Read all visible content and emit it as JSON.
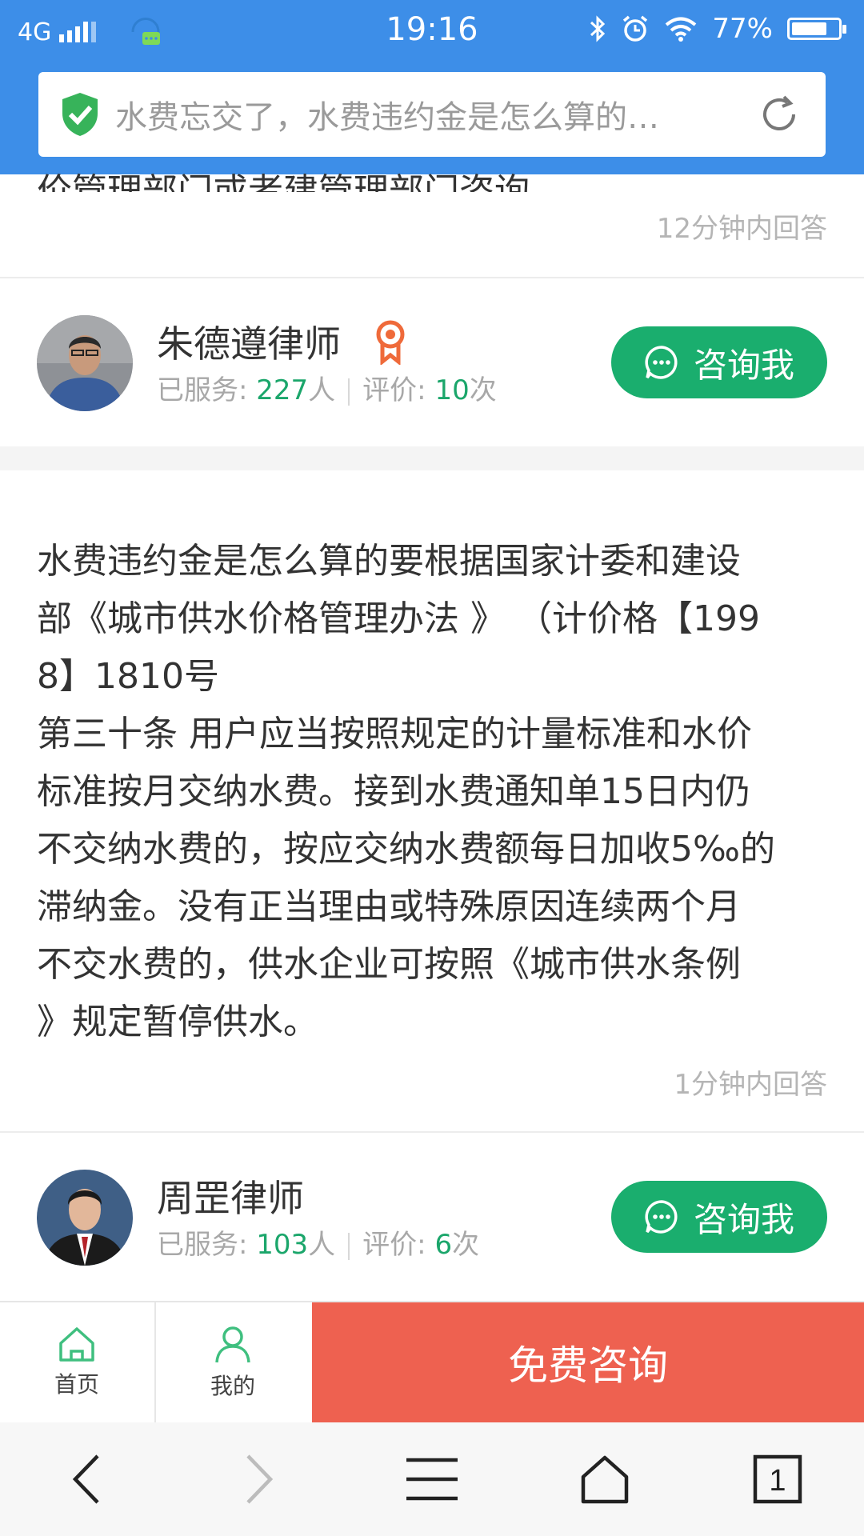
{
  "status": {
    "network": "4G",
    "time": "19:16",
    "battery": "77%",
    "battery_level": 0.77
  },
  "browser": {
    "url_text": "水费忘交了，水费违约金是怎么算的…"
  },
  "prev_answer": {
    "partial_text": "价管理部门或者建管理部门咨询。",
    "time_note": "12分钟内回答"
  },
  "lawyer1": {
    "name": "朱德遵律师",
    "served_label": "已服务: ",
    "served_count": "227",
    "served_unit": "人",
    "rating_label": "评价: ",
    "rating_count": "10",
    "rating_unit": "次",
    "button": "咨询我"
  },
  "answer": {
    "text": "水费违约金是怎么算的要根据国家计委和建设\n部《城市供水价格管理办法 》 （计价格【199\n8】1810号\n第三十条 用户应当按照规定的计量标准和水价\n标准按月交纳水费。接到水费通知单15日内仍\n不交纳水费的，按应交纳水费额每日加收5‰的\n滞纳金。没有正当理由或特殊原因连续两个月\n不交水费的，供水企业可按照《城市供水条例\n》规定暂停供水。",
    "time_note": "1分钟内回答"
  },
  "lawyer2": {
    "name": "周罡律师",
    "served_label": "已服务: ",
    "served_count": "103",
    "served_unit": "人",
    "rating_label": "评价: ",
    "rating_count": "6",
    "rating_unit": "次",
    "button": "咨询我"
  },
  "appbar": {
    "home": "首页",
    "mine": "我的",
    "free_consult": "免费咨询"
  },
  "browser_nav": {
    "tab_count": "1"
  },
  "colors": {
    "header_blue": "#3d8ee8",
    "green": "#1aae6e",
    "red": "#ee6150"
  }
}
